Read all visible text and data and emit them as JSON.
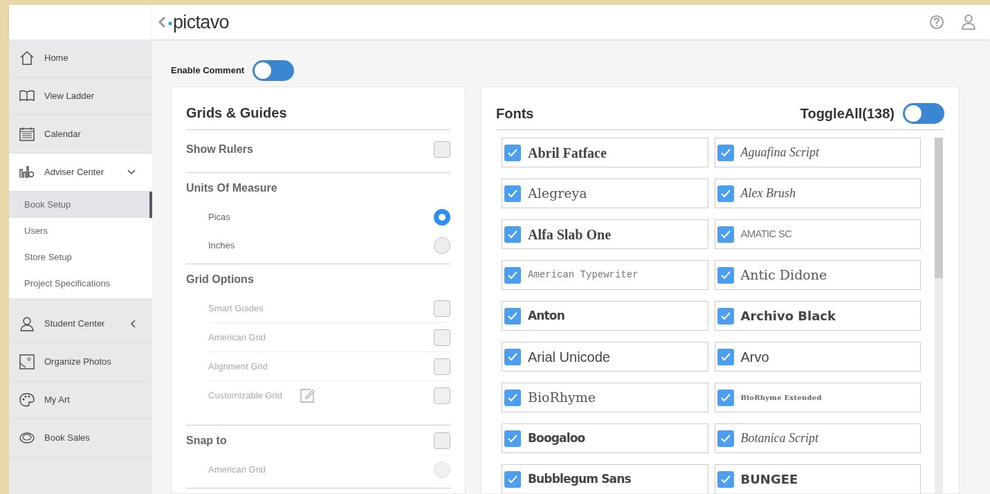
{
  "header": {
    "logo": "pictavo"
  },
  "sidebar": {
    "items": [
      {
        "label": "Home",
        "kind": "home",
        "expanded": false
      },
      {
        "label": "View Ladder",
        "kind": "book",
        "expanded": false
      },
      {
        "label": "Calendar",
        "kind": "calendar",
        "expanded": false
      },
      {
        "label": "Adviser Center",
        "kind": "chart",
        "expanded": true,
        "children": [
          {
            "label": "Book Setup",
            "selected": true
          },
          {
            "label": "Users",
            "selected": false
          },
          {
            "label": "Store Setup",
            "selected": false
          },
          {
            "label": "Project Specifications",
            "selected": false
          }
        ]
      },
      {
        "label": "Student Center",
        "kind": "person",
        "expanded": false
      },
      {
        "label": "Organize Photos",
        "kind": "photo",
        "expanded": false
      },
      {
        "label": "My Art",
        "kind": "palette",
        "expanded": false
      },
      {
        "label": "Book Sales",
        "kind": "coin",
        "expanded": false
      }
    ]
  },
  "enable_comment": {
    "label": "Enable Comment",
    "on": false
  },
  "grids_guides": {
    "title": "Grids & Guides",
    "sections": [
      {
        "title": "Show Rulers",
        "kind": "checkbox",
        "checked": false
      },
      {
        "title": "Units Of Measure",
        "options": [
          {
            "label": "Picas",
            "kind": "radio",
            "selected": true,
            "disabled": false
          },
          {
            "label": "Inches",
            "kind": "radio",
            "selected": false,
            "disabled": false
          }
        ]
      },
      {
        "title": "Grid Options",
        "options": [
          {
            "label": "Smart Guides",
            "kind": "checkbox",
            "checked": false,
            "disabled": true
          },
          {
            "label": "American Grid",
            "kind": "checkbox",
            "checked": false,
            "disabled": true
          },
          {
            "label": "Alignment Grid",
            "kind": "checkbox",
            "checked": false,
            "disabled": true
          },
          {
            "label": "Customizable Grid",
            "kind": "checkbox",
            "checked": false,
            "disabled": true,
            "editable": true
          }
        ]
      },
      {
        "title": "Snap to",
        "kind": "checkbox",
        "checked": false,
        "options": [
          {
            "label": "American Grid",
            "kind": "radio",
            "selected": false,
            "disabled": true
          }
        ]
      }
    ]
  },
  "fonts": {
    "title": "Fonts",
    "toggle_all": {
      "label": "ToggleAll(138)",
      "on": false
    },
    "items": [
      {
        "label": "Abril Fatface",
        "checked": true,
        "kind": "bold-serif"
      },
      {
        "label": "Aguafina Script",
        "checked": true,
        "kind": "script"
      },
      {
        "label": "Alegreya",
        "checked": true,
        "kind": "serif"
      },
      {
        "label": "Alex Brush",
        "checked": true,
        "kind": "script"
      },
      {
        "label": "Alfa Slab One",
        "checked": true,
        "kind": "bold-serif"
      },
      {
        "label": "AMATIC SC",
        "checked": true,
        "kind": "thin"
      },
      {
        "label": "American Typewriter",
        "checked": true,
        "kind": "mono"
      },
      {
        "label": "Antic Didone",
        "checked": true,
        "kind": "serif"
      },
      {
        "label": "Anton",
        "checked": true,
        "kind": "condensed"
      },
      {
        "label": "Archivo Black",
        "checked": true,
        "kind": "bold-sans"
      },
      {
        "label": "Arial Unicode",
        "checked": true,
        "kind": "sans"
      },
      {
        "label": "Arvo",
        "checked": true,
        "kind": "sans"
      },
      {
        "label": "BioRhyme",
        "checked": true,
        "kind": "serif"
      },
      {
        "label": "BioRhyme Extended",
        "checked": true,
        "kind": "tiny"
      },
      {
        "label": "Boogaloo",
        "checked": true,
        "kind": "condensed"
      },
      {
        "label": "Botanica Script",
        "checked": true,
        "kind": "script"
      },
      {
        "label": "Bubblegum Sans",
        "checked": true,
        "kind": "condensed"
      },
      {
        "label": "BUNGEE",
        "checked": true,
        "kind": "bold-sans"
      }
    ]
  }
}
